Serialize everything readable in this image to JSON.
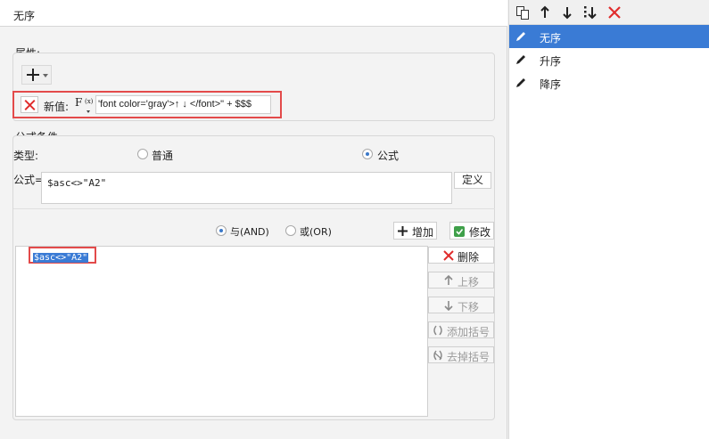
{
  "title": "无序",
  "properties": {
    "group_label": "属性:",
    "new_value_label": "新值:",
    "formula_icon_text": "F",
    "formula_icon_sub": "(x)",
    "new_value_expression": "'font color='gray'>↑ ↓ </font>\" + $$$"
  },
  "formula_condition": {
    "group_label": "公式条件",
    "type_label": "类型:",
    "type_options": [
      {
        "label": "普通",
        "selected": false
      },
      {
        "label": "公式",
        "selected": true
      }
    ],
    "formula_label": "公式=",
    "formula_value": "$asc<>\"A2\"",
    "define_button": "定义"
  },
  "logic": {
    "and_label": "与(AND)",
    "or_label": "或(OR)",
    "and_selected": true,
    "add_button": "增加",
    "modify_button": "修改"
  },
  "conditions": [
    "$asc<>\"A2\""
  ],
  "actions": {
    "delete": "删除",
    "move_up": "上移",
    "move_down": "下移",
    "add_bracket": "添加括号",
    "remove_bracket": "去掉括号"
  },
  "sort_list": [
    {
      "label": "无序",
      "selected": true
    },
    {
      "label": "升序",
      "selected": false
    },
    {
      "label": "降序",
      "selected": false
    }
  ],
  "colors": {
    "highlight_border": "#e34a4a",
    "selection": "#3a7bd5",
    "delete_icon": "#e02c2c"
  }
}
